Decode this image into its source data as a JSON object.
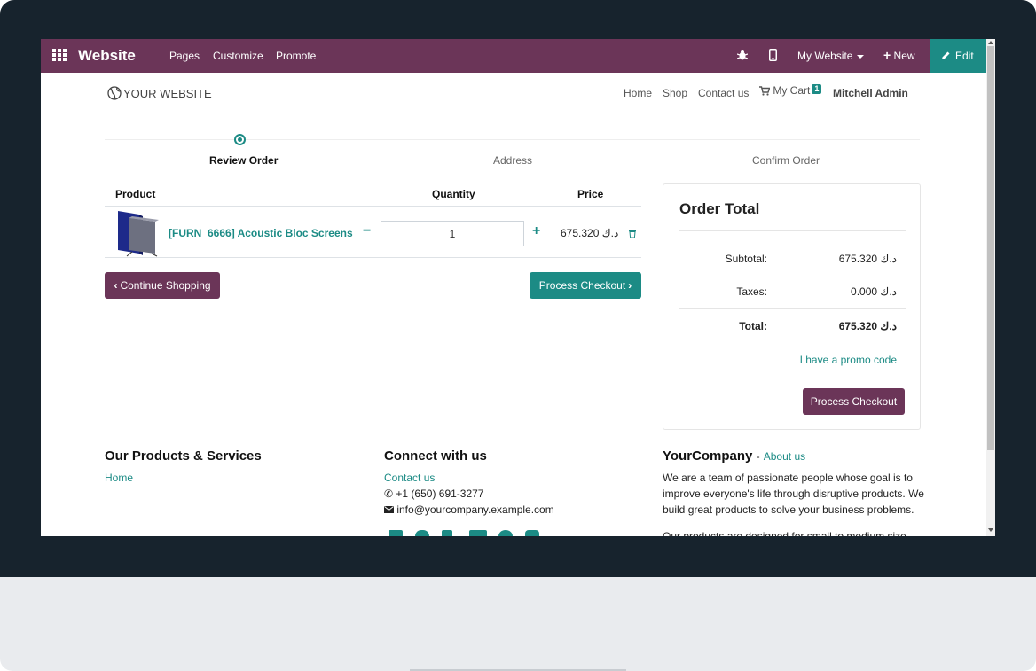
{
  "topbar": {
    "brand": "Website",
    "menu": [
      "Pages",
      "Customize",
      "Promote"
    ],
    "website_select": "My Website",
    "new_label": "New",
    "edit_label": "Edit"
  },
  "site": {
    "logo_text": "YOUR WEBSITE",
    "nav": [
      "Home",
      "Shop",
      "Contact us"
    ],
    "cart_label": "My Cart",
    "cart_count": "1",
    "user": "Mitchell Admin"
  },
  "progress": {
    "steps": [
      "Review Order",
      "Address",
      "Confirm Order"
    ],
    "active_step": 0
  },
  "cart": {
    "headers": {
      "product": "Product",
      "quantity": "Quantity",
      "price": "Price"
    },
    "items": [
      {
        "name": "[FURN_6666] Acoustic Bloc Screens",
        "quantity": "1",
        "price": "675.320 د.ك"
      }
    ],
    "continue_label": "Continue Shopping",
    "checkout_label": "Process Checkout"
  },
  "order_total": {
    "title": "Order Total",
    "subtotal_label": "Subtotal:",
    "subtotal_value": "675.320 د.ك",
    "taxes_label": "Taxes:",
    "taxes_value": "0.000 د.ك",
    "total_label": "Total:",
    "total_value": "675.320 د.ك",
    "promo_label": "I have a promo code",
    "checkout_label": "Process Checkout"
  },
  "footer": {
    "products": {
      "title": "Our Products & Services",
      "link": "Home"
    },
    "connect": {
      "title": "Connect with us",
      "contact": "Contact us",
      "phone": "+1 (650) 691-3277",
      "email": "info@yourcompany.example.com"
    },
    "company": {
      "title": "YourCompany",
      "about_link": "About us",
      "desc_line1": "We are a team of passionate people whose goal is to",
      "desc_line2": "improve everyone's life through disruptive products. We",
      "desc_line3": "build great products to solve your business problems.",
      "desc_line4": "Our products are designed for small to medium size"
    }
  },
  "colors": {
    "brand_purple": "#6b3558",
    "accent_teal": "#1c8b85"
  }
}
